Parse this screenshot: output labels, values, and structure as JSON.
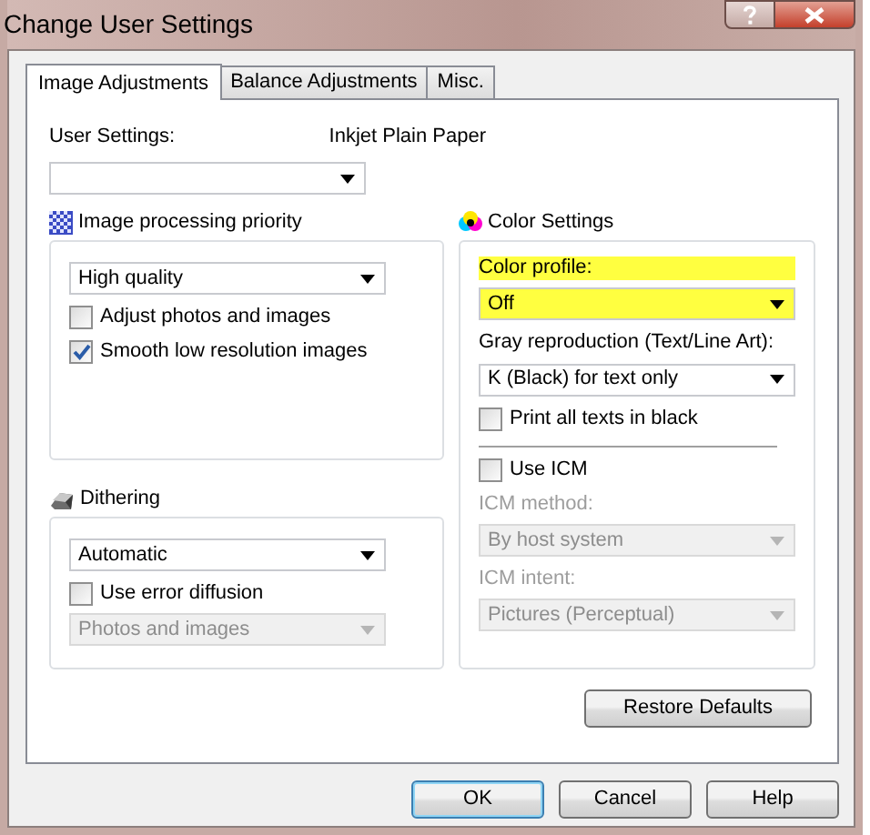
{
  "window": {
    "title": "Change User Settings"
  },
  "tabs": [
    {
      "label": "Image Adjustments",
      "selected": true
    },
    {
      "label": "Balance Adjustments",
      "selected": false
    },
    {
      "label": "Misc.",
      "selected": false
    }
  ],
  "user_settings": {
    "label": "User Settings:",
    "value": "Inkjet Plain Paper"
  },
  "left_sections": [
    {
      "title": "Image processing priority",
      "items": [
        {
          "kind": "dropdown",
          "value": "High quality",
          "disabled": false
        },
        {
          "kind": "checkbox",
          "label": "Adjust photos and images",
          "checked": false,
          "disabled": false
        },
        {
          "kind": "checkbox",
          "label": "Smooth low resolution images",
          "checked": true,
          "disabled": false
        }
      ]
    },
    {
      "title": "Dithering",
      "items": [
        {
          "kind": "dropdown",
          "value": "Automatic",
          "disabled": false
        },
        {
          "kind": "checkbox",
          "label": "Use error diffusion",
          "checked": false,
          "disabled": false
        },
        {
          "kind": "dropdown",
          "value": "Photos and images",
          "disabled": true
        }
      ]
    }
  ],
  "right_section": {
    "title": "Color Settings",
    "items": [
      {
        "kind": "label",
        "text": "Color profile:",
        "disabled": false,
        "highlighted": true
      },
      {
        "kind": "dropdown",
        "value": "Off",
        "disabled": false,
        "highlighted": true
      },
      {
        "kind": "label",
        "text": "Gray reproduction (Text/Line Art):",
        "disabled": false
      },
      {
        "kind": "dropdown",
        "value": "K (Black) for text only",
        "disabled": false
      },
      {
        "kind": "checkbox",
        "label": "Print all texts in black",
        "checked": false,
        "disabled": false
      },
      {
        "kind": "separator"
      },
      {
        "kind": "checkbox",
        "label": "Use ICM",
        "checked": false,
        "disabled": false
      },
      {
        "kind": "label",
        "text": "ICM method:",
        "disabled": true
      },
      {
        "kind": "dropdown",
        "value": "By host system",
        "disabled": true
      },
      {
        "kind": "label",
        "text": "ICM intent:",
        "disabled": true
      },
      {
        "kind": "dropdown",
        "value": "Pictures (Perceptual)",
        "disabled": true
      }
    ]
  },
  "restore_button": "Restore Defaults",
  "buttons": [
    {
      "label": "OK",
      "default": true
    },
    {
      "label": "Cancel",
      "default": false
    },
    {
      "label": "Help",
      "default": false
    }
  ]
}
